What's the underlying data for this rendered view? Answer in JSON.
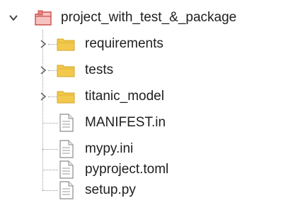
{
  "project": {
    "name": "project_with_test_&_package",
    "expanded": true,
    "icon": "project-folder-icon",
    "children": [
      {
        "label": "requirements",
        "type": "folder",
        "icon": "folder-icon",
        "expanded": false
      },
      {
        "label": "tests",
        "type": "folder",
        "icon": "folder-icon",
        "expanded": false
      },
      {
        "label": "titanic_model",
        "type": "folder",
        "icon": "folder-icon",
        "expanded": false
      },
      {
        "label": "MANIFEST.in",
        "type": "file",
        "icon": "file-icon"
      },
      {
        "label": "mypy.ini",
        "type": "file",
        "icon": "file-icon"
      },
      {
        "label": "pyproject.toml",
        "type": "file",
        "icon": "file-icon"
      },
      {
        "label": "setup.py",
        "type": "file",
        "icon": "file-icon"
      }
    ]
  },
  "colors": {
    "folder": "#f2c94c",
    "project_folder": "#e8837f",
    "text": "#1e1e1e",
    "connector": "#9a9a9a"
  }
}
